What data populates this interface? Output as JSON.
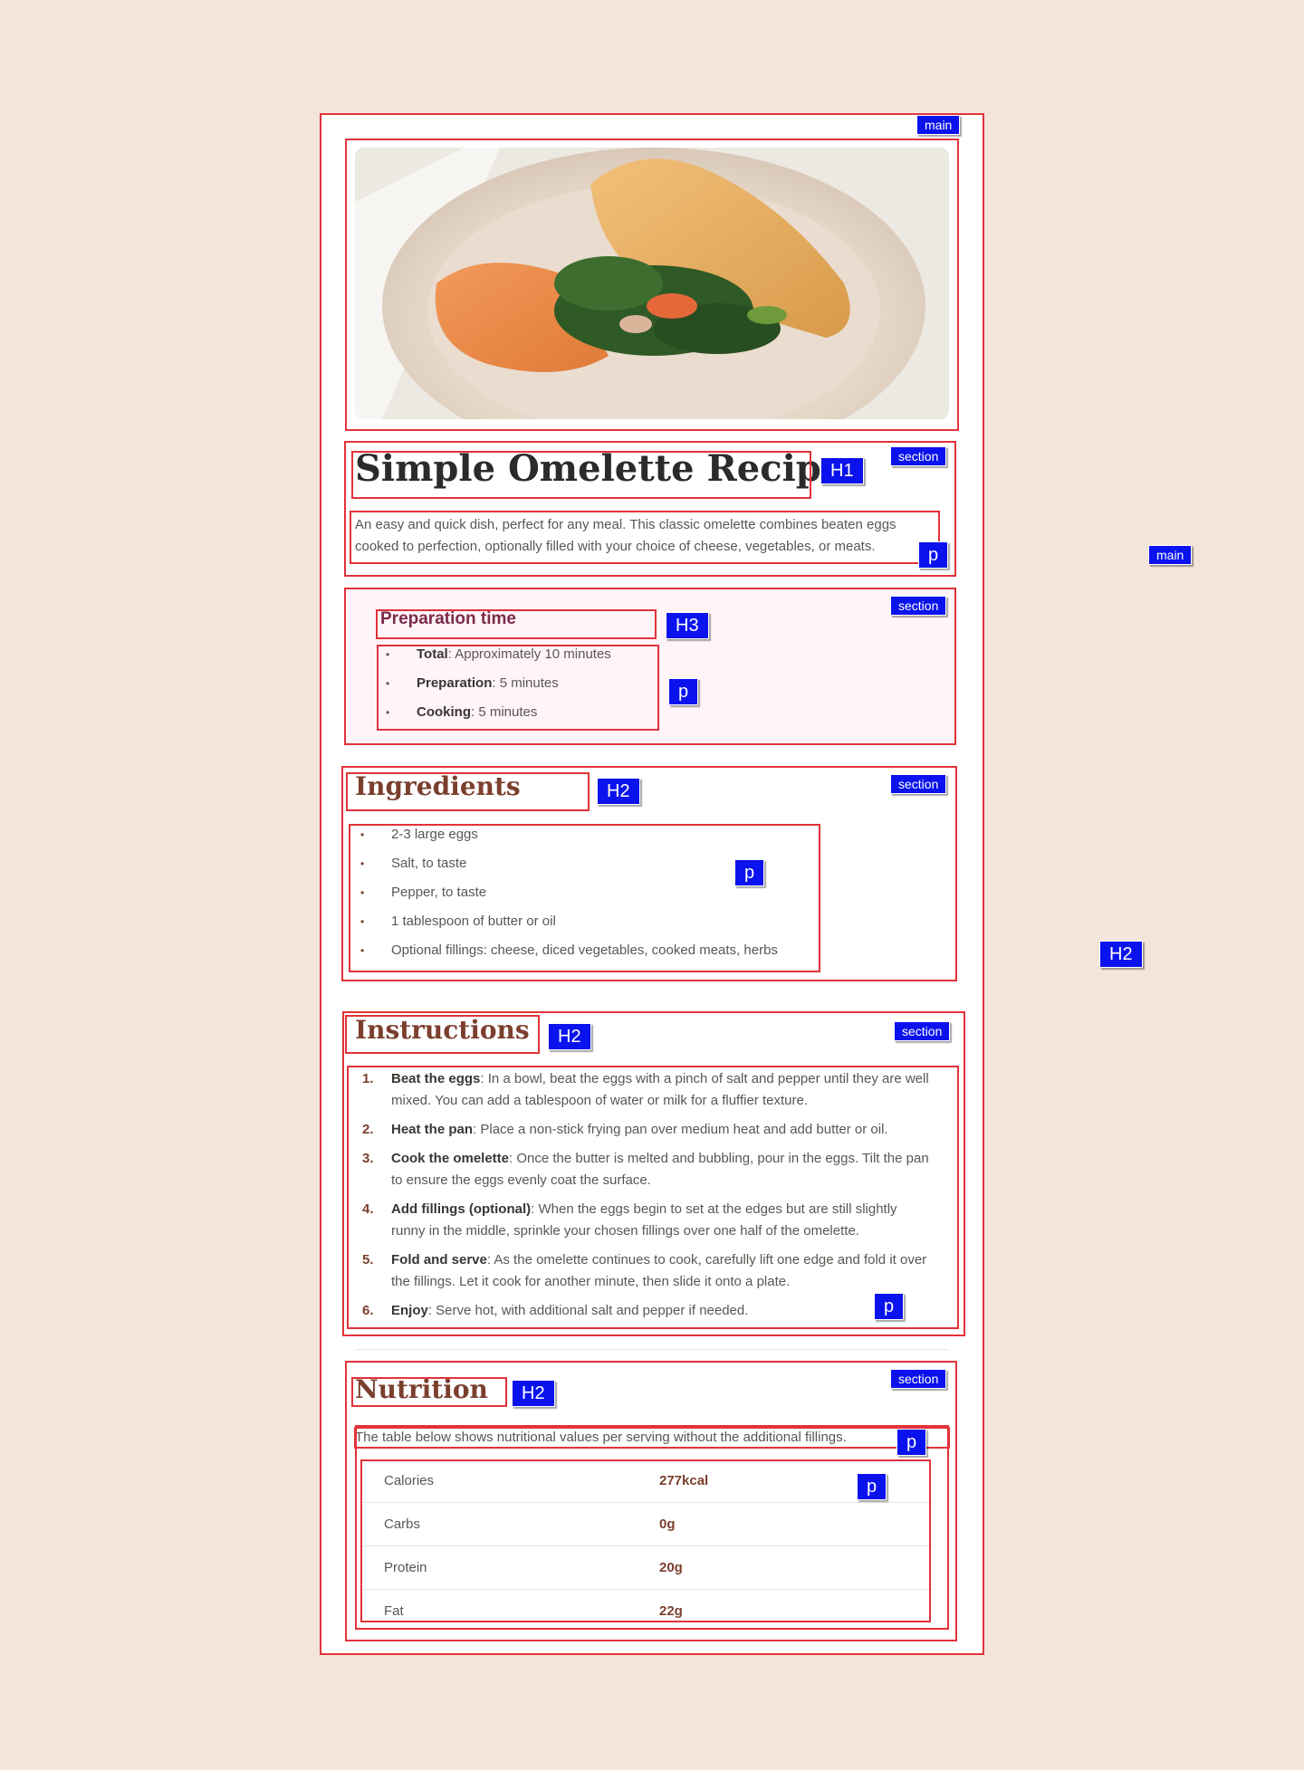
{
  "recipe": {
    "title": "Simple Omelette Recipe",
    "intro": "An easy and quick dish, perfect for any meal. This classic omelette combines beaten eggs cooked to perfection, optionally filled with your choice of cheese, vegetables, or meats."
  },
  "preparation": {
    "heading": "Preparation time",
    "items": [
      {
        "label": "Total",
        "value": ": Approximately 10 minutes"
      },
      {
        "label": "Preparation",
        "value": ": 5 minutes"
      },
      {
        "label": "Cooking",
        "value": ": 5 minutes"
      }
    ]
  },
  "ingredients": {
    "heading": "Ingredients",
    "items": [
      "2-3 large eggs",
      "Salt, to taste",
      "Pepper, to taste",
      "1 tablespoon of butter or oil",
      "Optional fillings: cheese, diced vegetables, cooked meats, herbs"
    ]
  },
  "instructions": {
    "heading": "Instructions",
    "steps": [
      {
        "num": "1.",
        "label": "Beat the eggs",
        "text": ": In a bowl, beat the eggs with a pinch of salt and pepper until they are well mixed. You can add a tablespoon of water or milk for a fluffier texture."
      },
      {
        "num": "2.",
        "label": "Heat the pan",
        "text": ": Place a non-stick frying pan over medium heat and add butter or oil."
      },
      {
        "num": "3.",
        "label": "Cook the omelette",
        "text": ": Once the butter is melted and bubbling, pour in the eggs. Tilt the pan to ensure the eggs evenly coat the surface."
      },
      {
        "num": "4.",
        "label": "Add fillings (optional)",
        "text": ": When the eggs begin to set at the edges but are still slightly runny in the middle, sprinkle your chosen fillings over one half of the omelette."
      },
      {
        "num": "5.",
        "label": "Fold and serve",
        "text": ": As the omelette continues to cook, carefully lift one edge and fold it over the fillings. Let it cook for another minute, then slide it onto a plate."
      },
      {
        "num": "6.",
        "label": "Enjoy",
        "text": ": Serve hot, with additional salt and pepper if needed."
      }
    ]
  },
  "nutrition": {
    "heading": "Nutrition",
    "intro": "The table below shows nutritional values per serving without the additional fillings.",
    "rows": [
      {
        "label": "Calories",
        "value": "277kcal"
      },
      {
        "label": "Carbs",
        "value": "0g"
      },
      {
        "label": "Protein",
        "value": "20g"
      },
      {
        "label": "Fat",
        "value": "22g"
      }
    ]
  },
  "overlay_tags": {
    "main": "main",
    "section": "section",
    "h1": "H1",
    "h2": "H2",
    "h3": "H3",
    "p": "p"
  },
  "colors": {
    "page_background": "#f3e5da",
    "heading_brown": "#7b3f2e",
    "prep_heading": "#7b2a4a",
    "prep_background": "#fff4f8",
    "annotation_box": "#e2323a",
    "annotation_tag": "#0a12ee"
  },
  "icons": {
    "hero_image": "omelette-photo"
  }
}
